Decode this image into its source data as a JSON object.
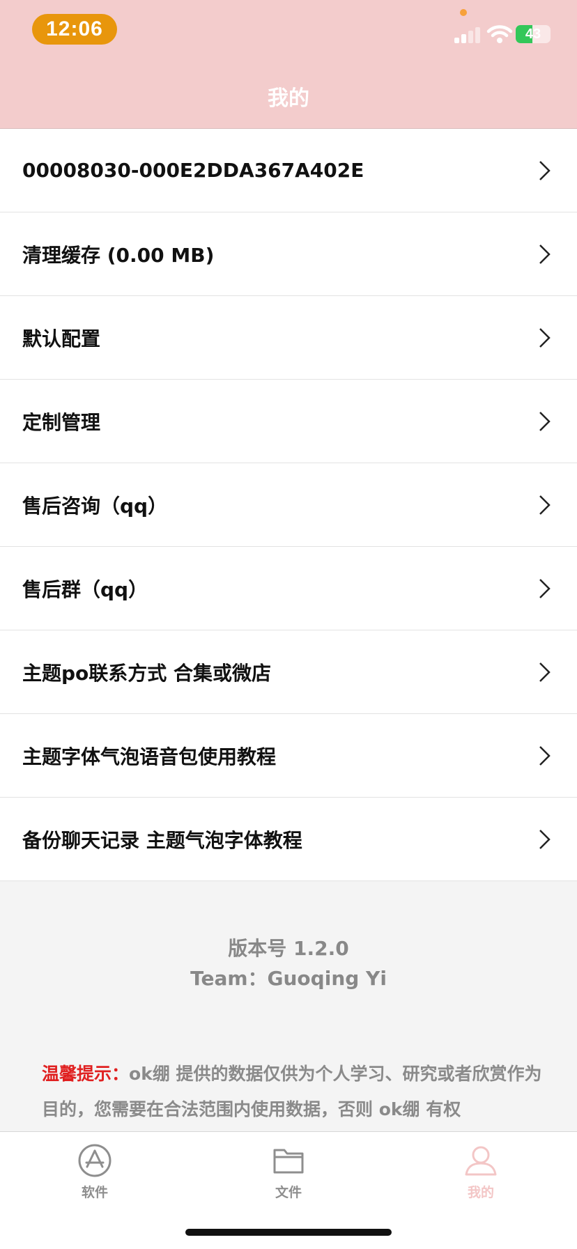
{
  "status_bar": {
    "time": "12:06",
    "battery": "43"
  },
  "nav": {
    "title": "我的"
  },
  "menu": [
    {
      "label": "00008030-000E2DDA367A402E"
    },
    {
      "label": "清理缓存 (0.00 MB)"
    },
    {
      "label": "默认配置"
    },
    {
      "label": "定制管理"
    },
    {
      "label": "售后咨询（qq）"
    },
    {
      "label": "售后群（qq）"
    },
    {
      "label": "主题po联系方式 合集或微店"
    },
    {
      "label": "主题字体气泡语音包使用教程"
    },
    {
      "label": "备份聊天记录 主题气泡字体教程"
    }
  ],
  "info": {
    "version": "版本号 1.2.0",
    "team": "Team：Guoqing Yi"
  },
  "notice": {
    "prefix": "温馨提示：",
    "text": "ok绷 提供的数据仅供为个人学习、研究或者欣赏作为目的，您需要在合法范围内使用数据，否则 ok绷 有权"
  },
  "tabs": [
    {
      "label": "软件",
      "icon": "app-store-icon",
      "active": false
    },
    {
      "label": "文件",
      "icon": "folder-icon",
      "active": false
    },
    {
      "label": "我的",
      "icon": "person-icon",
      "active": true
    }
  ],
  "colors": {
    "header_bg": "#f3cccc",
    "time_pill": "#e8960c",
    "tab_active": "#f3c6c6",
    "tab_inactive": "#8e8e8e",
    "warning": "#e02020"
  }
}
